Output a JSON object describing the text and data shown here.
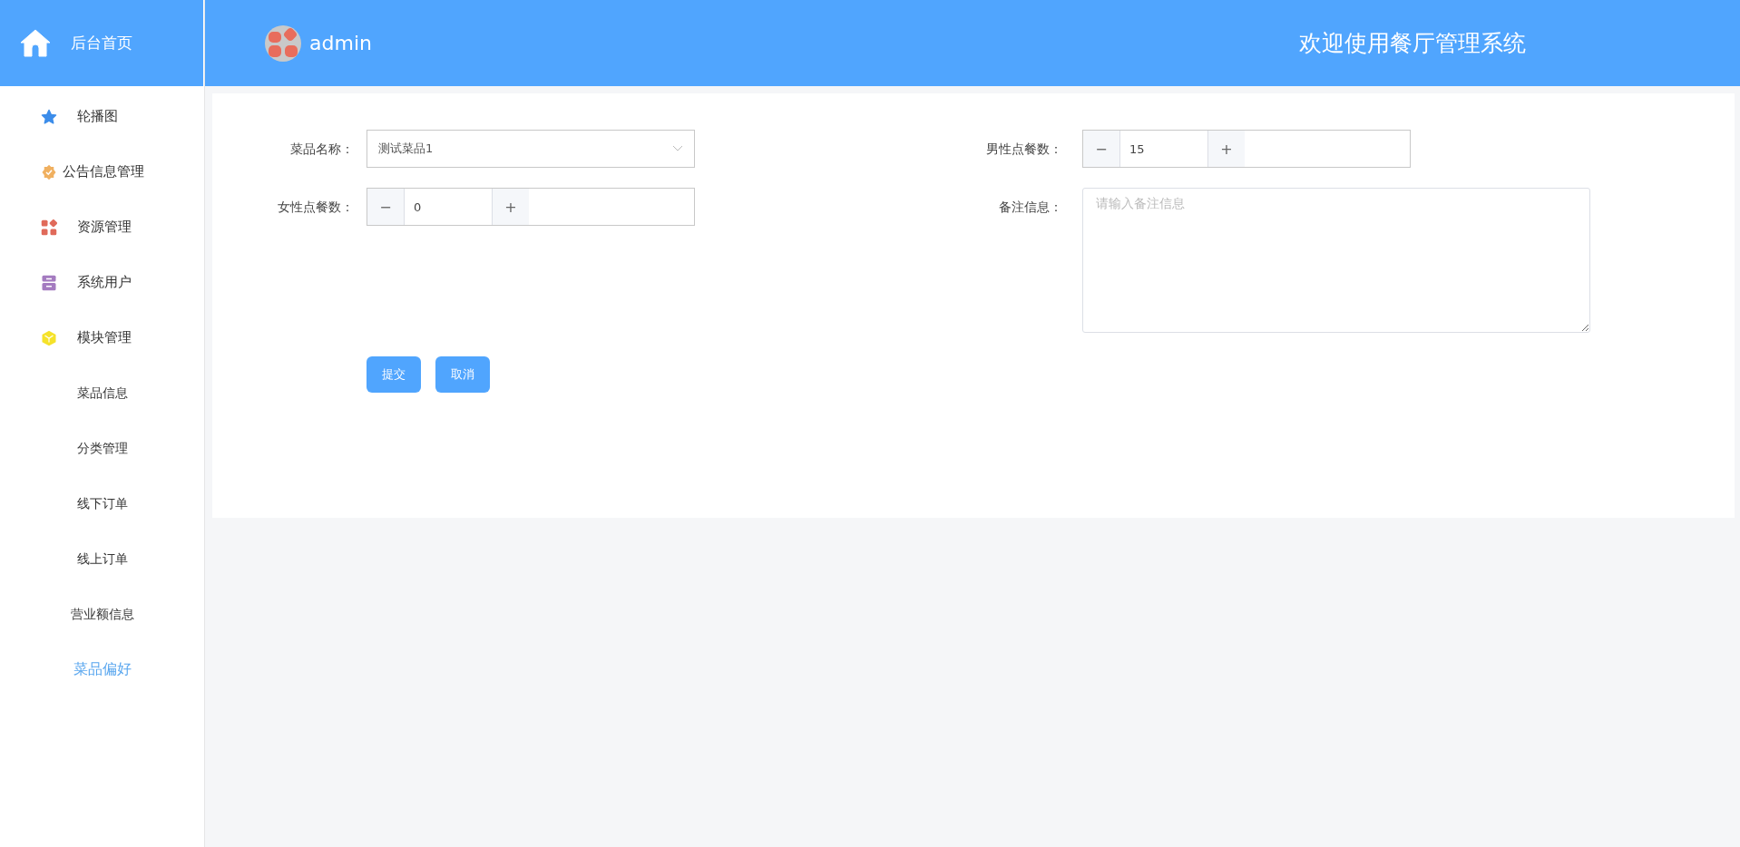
{
  "sidebar": {
    "home": {
      "label": "后台首页"
    },
    "items": [
      {
        "label": "轮播图",
        "selected": false
      },
      {
        "label": "公告信息管理",
        "selected": false
      },
      {
        "label": "资源管理",
        "selected": false
      },
      {
        "label": "系统用户",
        "selected": false
      },
      {
        "label": "模块管理",
        "selected": false,
        "children": [
          {
            "label": "菜品信息",
            "selected": false
          },
          {
            "label": "分类管理",
            "selected": false
          },
          {
            "label": "线下订单",
            "selected": false
          },
          {
            "label": "线上订单",
            "selected": false
          },
          {
            "label": "营业额信息",
            "selected": false
          },
          {
            "label": "菜品偏好",
            "selected": true
          }
        ]
      }
    ]
  },
  "header": {
    "user": "admin",
    "title": "欢迎使用餐厅管理系统"
  },
  "form": {
    "fields": [
      {
        "kind": "select",
        "label": "菜品名称：",
        "value": "测试菜品1"
      },
      {
        "kind": "number",
        "label": "男性点餐数：",
        "value": "15",
        "minus": "−",
        "plus": "+"
      },
      {
        "kind": "number",
        "label": "女性点餐数：",
        "value": "0",
        "minus": "−",
        "plus": "+"
      },
      {
        "kind": "textarea",
        "label": "备注信息：",
        "placeholder": "请输入备注信息"
      }
    ],
    "buttons": [
      "提交",
      "取消"
    ]
  }
}
